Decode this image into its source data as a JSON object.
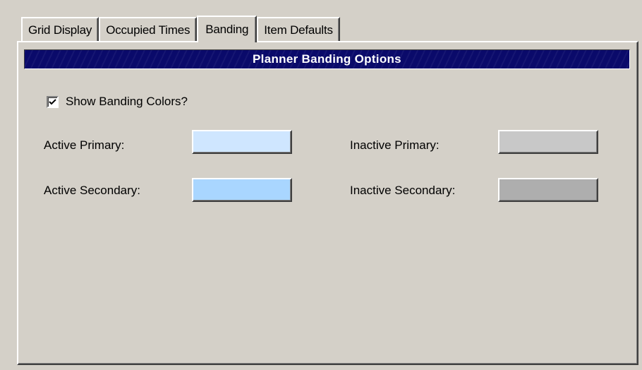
{
  "tabs": [
    {
      "label": "Grid Display",
      "selected": false
    },
    {
      "label": "Occupied Times",
      "selected": false
    },
    {
      "label": "Banding",
      "selected": true
    },
    {
      "label": "Item Defaults",
      "selected": false
    }
  ],
  "panel": {
    "title": "Planner Banding Options",
    "title_bar_color": "#0a0a6a"
  },
  "show_banding": {
    "label": "Show Banding Colors?",
    "checked": true
  },
  "colors": {
    "active_primary": {
      "label": "Active Primary:",
      "swatch": "#cfe6ff"
    },
    "active_secondary": {
      "label": "Active Secondary:",
      "swatch": "#a9d6ff"
    },
    "inactive_primary": {
      "label": "Inactive Primary:",
      "swatch": "#c8c8c8"
    },
    "inactive_secondary": {
      "label": "Inactive Secondary:",
      "swatch": "#aeaeae"
    }
  }
}
